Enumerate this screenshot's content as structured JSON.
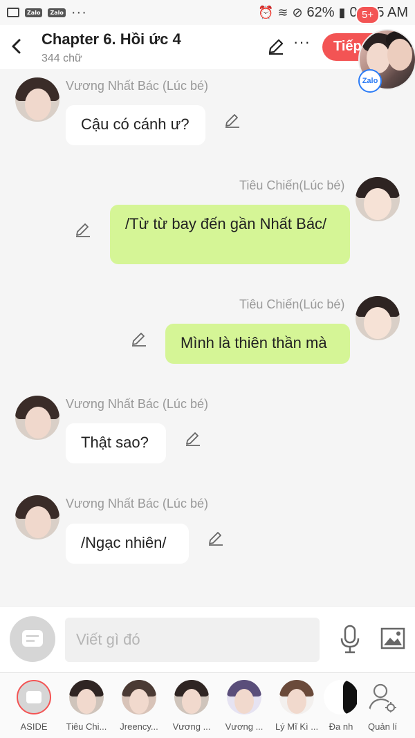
{
  "status_bar": {
    "battery": "62%",
    "time": "08:15 AM",
    "app_icons": [
      "image-icon",
      "zalo-icon",
      "zalo-icon"
    ],
    "zalo_label": "Zalo"
  },
  "header": {
    "title": "Chapter 6. Hồi ức 4",
    "word_count": "344 chữ",
    "next_label": "Tiếp",
    "badge": "5+",
    "zalo_chip": "Zalo"
  },
  "messages": [
    {
      "side": "left",
      "name": "Vương Nhất Bác (Lúc bé)",
      "text": "Cậu có cánh ư?"
    },
    {
      "side": "right",
      "name": "Tiêu Chiến(Lúc bé)",
      "text": "/Từ từ bay đến gần Nhất Bác/"
    },
    {
      "side": "right",
      "name": "Tiêu Chiến(Lúc bé)",
      "text": "Mình là thiên thần mà"
    },
    {
      "side": "left",
      "name": "Vương Nhất Bác (Lúc bé)",
      "text": "Thật sao?"
    },
    {
      "side": "left",
      "name": "Vương Nhất Bác (Lúc bé)",
      "text": "/Ngạc nhiên/"
    }
  ],
  "input": {
    "placeholder": "Viết gì đó"
  },
  "characters": [
    {
      "label": "ASIDE"
    },
    {
      "label": "Tiêu Chi..."
    },
    {
      "label": "Jreency..."
    },
    {
      "label": "Vương ..."
    },
    {
      "label": "Vương ..."
    },
    {
      "label": "Lý Mĩ Kì ..."
    },
    {
      "label": "Đa nh"
    },
    {
      "label": "Quản lí"
    }
  ]
}
